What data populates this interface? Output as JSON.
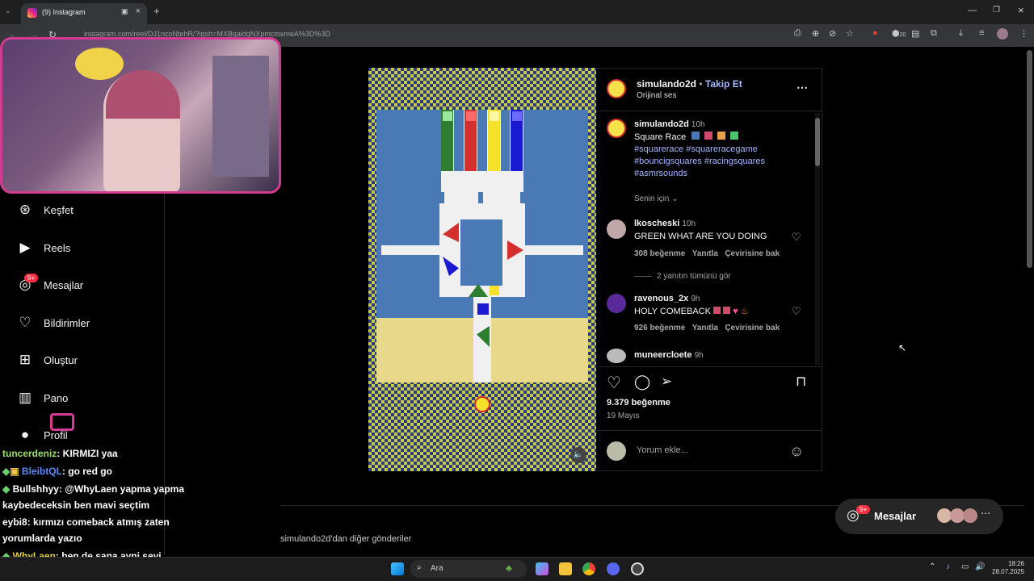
{
  "browser": {
    "tab_title": "(9) Instagram",
    "url": "instagram.com/reel/DJ1ncoNtehR/?igsh=MXBqaidqNXpmcmxmeA%3D%3D",
    "extension_badge": "20"
  },
  "sidebar": {
    "items": [
      {
        "label": "Keşfet",
        "icon": "compass-icon"
      },
      {
        "label": "Reels",
        "icon": "reels-icon"
      },
      {
        "label": "Mesajlar",
        "icon": "messenger-icon",
        "badge": "9+"
      },
      {
        "label": "Bildirimler",
        "icon": "heart-icon"
      },
      {
        "label": "Oluştur",
        "icon": "plus-icon"
      },
      {
        "label": "Pano",
        "icon": "dashboard-icon"
      },
      {
        "label": "Profil",
        "icon": "avatar-icon"
      }
    ]
  },
  "chat": [
    {
      "user": "tuncerdeniz",
      "color": "#9adf6a",
      "msg": ": KIRMIZI yaa"
    },
    {
      "user": "BleibtQL",
      "color": "#5a8aff",
      "msg": ": go red go"
    },
    {
      "user": "Bullshhyy",
      "color": "#e0e0e0",
      "msg": ": @WhyLaen yapma yapma kaybedeceksin ben mavi seçtim"
    },
    {
      "user": "eybi8",
      "color": "#e0e0e0",
      "msg": ": kırmızı comeback atmış zaten yorumlarda yazıo"
    },
    {
      "user": "WhyLaen",
      "color": "#e6d24a",
      "msg": ": ben de sana ayni seyi soylerdim mavi sectigini gorseydim"
    }
  ],
  "post": {
    "username": "simulando2d",
    "follow_label": "Takip Et",
    "audio": "Orijinal ses",
    "caption_user": "simulando2d",
    "caption_time": "10h",
    "caption_title": "Square Race",
    "hashtags": "#squarerace #squareracegame #bouncigsquares #racingsquares #asmrsounds",
    "filter_label": "Senin için",
    "likes": "9.379 beğenme",
    "date": "19 Mayıs",
    "comment_placeholder": "Yorum ekle...",
    "more_posts": "simulando2d'dan diğer gönderiler",
    "caption_squares": [
      "#4a7ab5",
      "#d14a6a",
      "#e8a04a",
      "#4ac46a"
    ]
  },
  "comments": [
    {
      "user": "lkoscheski",
      "time": "10h",
      "text": "GREEN WHAT ARE YOU DOING",
      "likes": "308 beğenme",
      "reply": "Yanıtla",
      "translate": "Çevirisine bak",
      "replies": "2 yanıtın tümünü gör"
    },
    {
      "user": "ravenous_2x",
      "time": "9h",
      "text": "HOLY COMEBACK",
      "likes": "926 beğenme",
      "reply": "Yanıtla",
      "translate": "Çevirisine bak"
    },
    {
      "user": "muneercloete",
      "time": "9h",
      "text": ""
    }
  ],
  "floating": {
    "label": "Mesajlar",
    "badge": "9+"
  },
  "taskbar": {
    "search": "Ara",
    "time": "18:26",
    "date": "28.07.2025"
  },
  "colors": {
    "red": "#d32f2f",
    "green": "#2e7d32",
    "yellow": "#f5e02a",
    "blue": "#1a1ad0",
    "accent": "#a4b8ff"
  }
}
